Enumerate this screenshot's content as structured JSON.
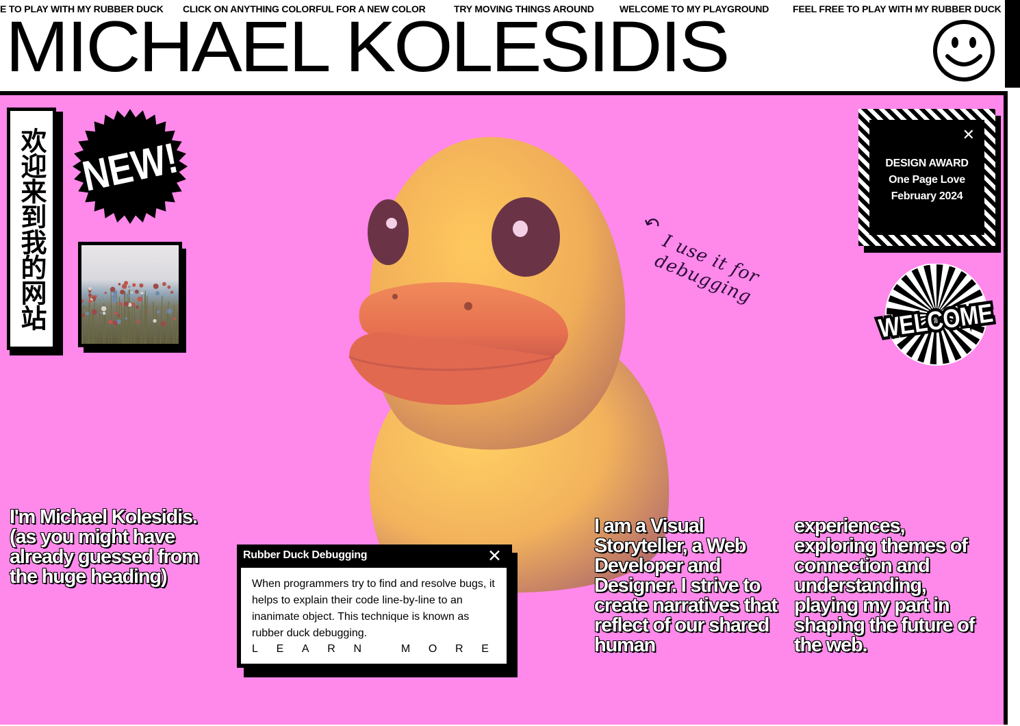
{
  "marquee": {
    "items": [
      "E TO PLAY WITH MY RUBBER DUCK",
      "CLICK ON ANYTHING COLORFUL FOR A NEW COLOR",
      "TRY MOVING THINGS AROUND",
      "WELCOME TO MY PLAYGROUND",
      "FEEL FREE TO PLAY WITH MY RUBBER DUCK"
    ]
  },
  "header": {
    "title": "MICHAEL KOLESIDIS",
    "icon": "smiley-face-icon"
  },
  "stage": {
    "background": "#ff88eb",
    "chinese_banner": "欢迎来到我的网站",
    "new_badge": "NEW!",
    "photo_icon": "flower-field-photo",
    "duck_icon": "rubber-duck-3d",
    "duck_note": "I use it for debugging",
    "award": {
      "title": "DESIGN AWARD",
      "source": "One Page Love",
      "date": "February 2024",
      "close": "✕"
    },
    "welcome_badge": "WELCOME",
    "intro": "I'm Michael Kolesidis. (as you might have already guessed from the huge heading)",
    "bio_column_1": "I am a Visual Storyteller, a Web Developer and Designer. I strive to create narratives that reflect of our shared human",
    "bio_column_2": "experiences, exploring themes of connection and understanding, playing my part in shaping the future of the web.",
    "debug_card": {
      "title": "Rubber Duck Debugging",
      "close": "✕",
      "text": "When programmers try to find and resolve bugs, it helps to explain their code line-by-line to an inanimate object. This technique is known as rubber duck debugging.",
      "link": "LEARN MORE"
    }
  }
}
